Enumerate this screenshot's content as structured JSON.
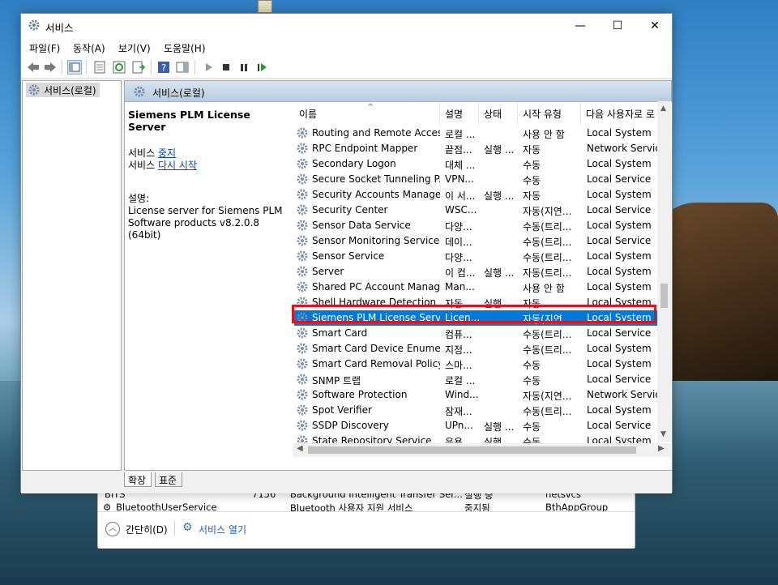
{
  "window": {
    "title": "서비스"
  },
  "menu": [
    "파일(F)",
    "동작(A)",
    "보기(V)",
    "도움말(H)"
  ],
  "tree": {
    "root": "서비스(로컬)"
  },
  "pane": {
    "header": "서비스(로컬)",
    "selected_name": "Siemens PLM License Server",
    "stop_prefix": "서비스 ",
    "stop_link": "중지",
    "restart_prefix": "서비스 ",
    "restart_link": "다시 시작",
    "desc_label": "설명:",
    "desc_text": "License server for Siemens PLM Software products v8.2.0.8 (64bit)"
  },
  "columns": [
    "이름",
    "설명",
    "상태",
    "시작 유형",
    "다음 사용자로 로"
  ],
  "services": [
    {
      "name": "Routing and Remote Access",
      "desc": "로컬 ...",
      "status": "",
      "startup": "사용 안 함",
      "logon": "Local System"
    },
    {
      "name": "RPC Endpoint Mapper",
      "desc": "끝점...",
      "status": "실행 ...",
      "startup": "자동",
      "logon": "Network Service"
    },
    {
      "name": "Secondary Logon",
      "desc": "대체 ...",
      "status": "",
      "startup": "수동",
      "logon": "Local System"
    },
    {
      "name": "Secure Socket Tunneling P...",
      "desc": "VPN...",
      "status": "",
      "startup": "수동",
      "logon": "Local Service"
    },
    {
      "name": "Security Accounts Manager",
      "desc": "이 서...",
      "status": "실행 ...",
      "startup": "자동",
      "logon": "Local System"
    },
    {
      "name": "Security Center",
      "desc": "WSC...",
      "status": "",
      "startup": "자동(지연...",
      "logon": "Local Service"
    },
    {
      "name": "Sensor Data Service",
      "desc": "다양...",
      "status": "",
      "startup": "수동(트리...",
      "logon": "Local System"
    },
    {
      "name": "Sensor Monitoring Service",
      "desc": "데이...",
      "status": "",
      "startup": "수동(트리...",
      "logon": "Local Service"
    },
    {
      "name": "Sensor Service",
      "desc": "다양...",
      "status": "",
      "startup": "수동(트리...",
      "logon": "Local System"
    },
    {
      "name": "Server",
      "desc": "이 컴...",
      "status": "실행 ...",
      "startup": "자동(트리...",
      "logon": "Local System"
    },
    {
      "name": "Shared PC Account Manager",
      "desc": "Man...",
      "status": "",
      "startup": "사용 안 함",
      "logon": "Local System"
    },
    {
      "name": "Shell Hardware Detection",
      "desc": "자동 ...",
      "status": "실행 ...",
      "startup": "자동",
      "logon": "Local System"
    },
    {
      "name": "Siemens PLM License Server",
      "desc": "Licen...",
      "status": "",
      "startup": "자동(지연...",
      "logon": "Local System"
    },
    {
      "name": "Smart Card",
      "desc": "컴퓨...",
      "status": "",
      "startup": "수동(트리...",
      "logon": "Local Service"
    },
    {
      "name": "Smart Card Device Enumer...",
      "desc": "지정...",
      "status": "",
      "startup": "수동(트리...",
      "logon": "Local System"
    },
    {
      "name": "Smart Card Removal Policy",
      "desc": "스마...",
      "status": "",
      "startup": "수동",
      "logon": "Local System"
    },
    {
      "name": "SNMP 트랩",
      "desc": "로컬 ...",
      "status": "",
      "startup": "수동",
      "logon": "Local Service"
    },
    {
      "name": "Software Protection",
      "desc": "Wind...",
      "status": "",
      "startup": "자동(지연...",
      "logon": "Network Service"
    },
    {
      "name": "Spot Verifier",
      "desc": "잠재...",
      "status": "",
      "startup": "수동(트리...",
      "logon": "Local System"
    },
    {
      "name": "SSDP Discovery",
      "desc": "UPn...",
      "status": "실행 ...",
      "startup": "수동",
      "logon": "Local Service"
    },
    {
      "name": "State Repository Service",
      "desc": "응용 ...",
      "status": "실행 ...",
      "startup": "수동",
      "logon": "Local System"
    }
  ],
  "selected_index": 12,
  "tabs": [
    "확장",
    "표준"
  ],
  "bg_window": {
    "rows": [
      {
        "name": "BITS",
        "pid": "7156",
        "desc": "Background Intelligent Transfer Ser...",
        "status": "실행 중",
        "group": "netsvcs"
      },
      {
        "name": "BluetoothUserService",
        "pid": "",
        "desc": "Bluetooth 사용자 지원 서비스",
        "status": "중지됨",
        "group": "BthAppGroup"
      }
    ],
    "collapse_label": "간단히(D)",
    "open_services_label": "서비스 열기"
  }
}
